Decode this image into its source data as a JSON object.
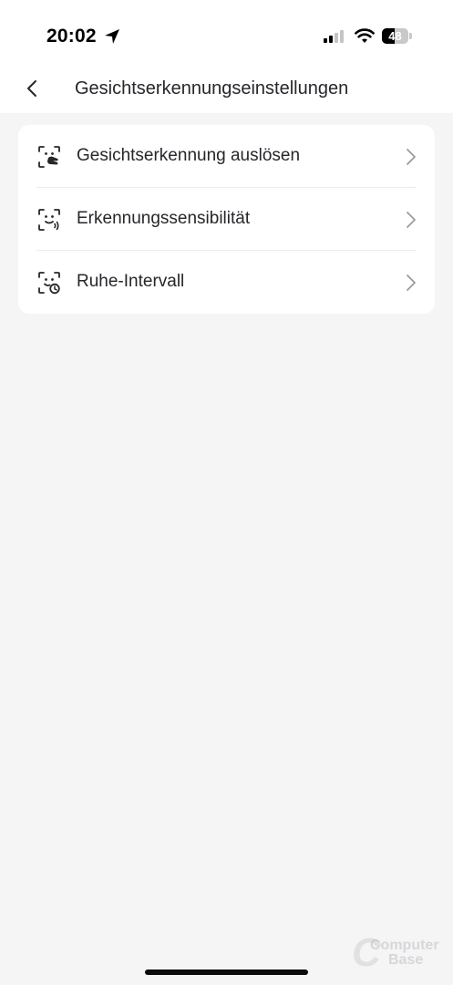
{
  "status_bar": {
    "time": "20:02",
    "battery_level": "48",
    "battery_fraction": 0.48,
    "signal_bars_active": 2,
    "signal_bars_total": 4
  },
  "nav": {
    "title": "Gesichtserkennungseinstellungen",
    "back_icon": "chevron-left-icon"
  },
  "settings": {
    "items": [
      {
        "label": "Gesichtserkennung auslösen",
        "icon": "face-scan-hand-icon"
      },
      {
        "label": "Erkennungssensibilität",
        "icon": "face-scan-signal-icon"
      },
      {
        "label": "Ruhe-Intervall",
        "icon": "face-scan-clock-icon"
      }
    ]
  },
  "watermark": {
    "line1": "Computer",
    "line2": "Base",
    "mark": "C"
  },
  "colors": {
    "background": "#f5f5f6",
    "card": "#ffffff",
    "text": "#26262b",
    "chevron": "#9a9aa0"
  }
}
